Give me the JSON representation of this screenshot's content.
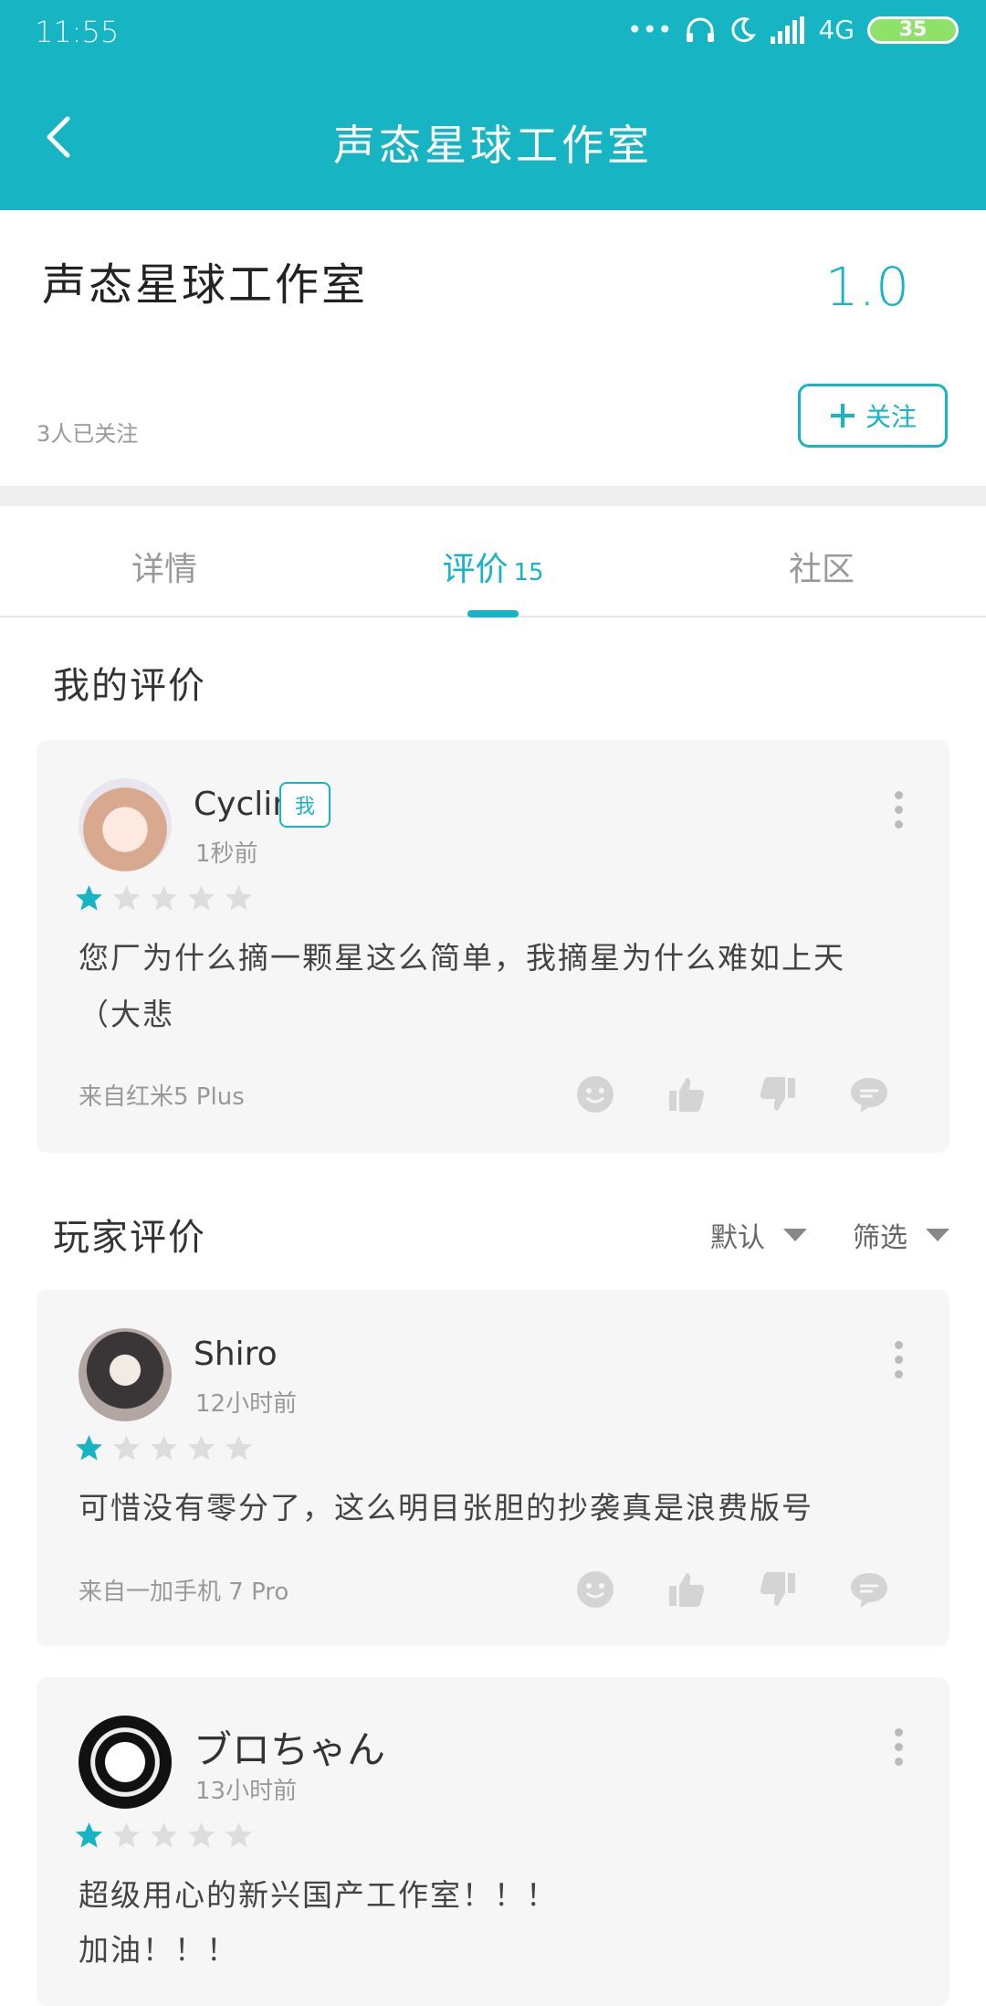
{
  "status": {
    "time": "11:55",
    "network": "4G",
    "battery": "35"
  },
  "appbar": {
    "title": "声态星球工作室"
  },
  "header": {
    "name": "声态星球工作室",
    "score": "1.0",
    "followers": "3人已关注",
    "follow_label": "关注"
  },
  "tabs": [
    {
      "label": "详情"
    },
    {
      "label": "评价",
      "count": "15"
    },
    {
      "label": "社区"
    }
  ],
  "my_review": {
    "section_title": "我的评价",
    "user": "Cyclin",
    "badge": "我",
    "time": "1秒前",
    "rating": 1,
    "text": "您厂为什么摘一颗星这么简单，我摘星为什么难如上天（大悲",
    "device": "来自红米5 Plus"
  },
  "player_reviews": {
    "section_title": "玩家评价",
    "sort_default": "默认",
    "sort_filter": "筛选",
    "items": [
      {
        "user": "Shiro",
        "time": "12小时前",
        "rating": 1,
        "text": "可惜没有零分了，这么明目张胆的抄袭真是浪费版号",
        "device": "来自一加手机 7 Pro"
      },
      {
        "user": "ブロちゃん",
        "time": "13小时前",
        "rating": 1,
        "text": "超级用心的新兴国产工作室！！！",
        "text2": "加油！！！"
      }
    ]
  },
  "colors": {
    "accent": "#17b5c4",
    "star_off": "#dddddd",
    "card_bg": "#f6f6f6"
  }
}
